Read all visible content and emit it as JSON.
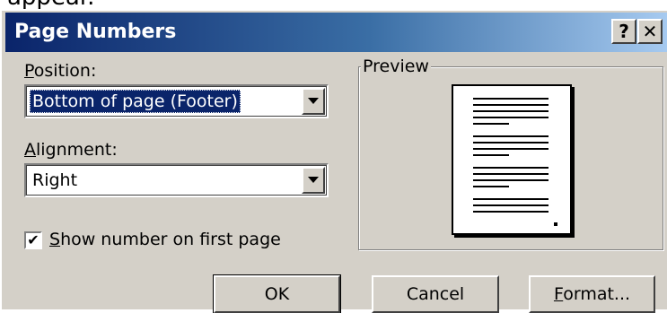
{
  "background_text": "appear.",
  "window": {
    "title": "Page Numbers",
    "help_label": "?",
    "close_label": "✕"
  },
  "position": {
    "label_mnemonic": "P",
    "label_rest": "osition:",
    "value": "Bottom of page (Footer)"
  },
  "alignment": {
    "label_mnemonic": "A",
    "label_rest": "lignment:",
    "value": "Right"
  },
  "show_first_page": {
    "checked": true,
    "check_glyph": "✔",
    "label_mnemonic": "S",
    "label_rest": "how number on first page"
  },
  "preview": {
    "legend": "Preview"
  },
  "buttons": {
    "ok": "OK",
    "cancel": "Cancel",
    "format_mnemonic": "F",
    "format_rest": "ormat..."
  }
}
